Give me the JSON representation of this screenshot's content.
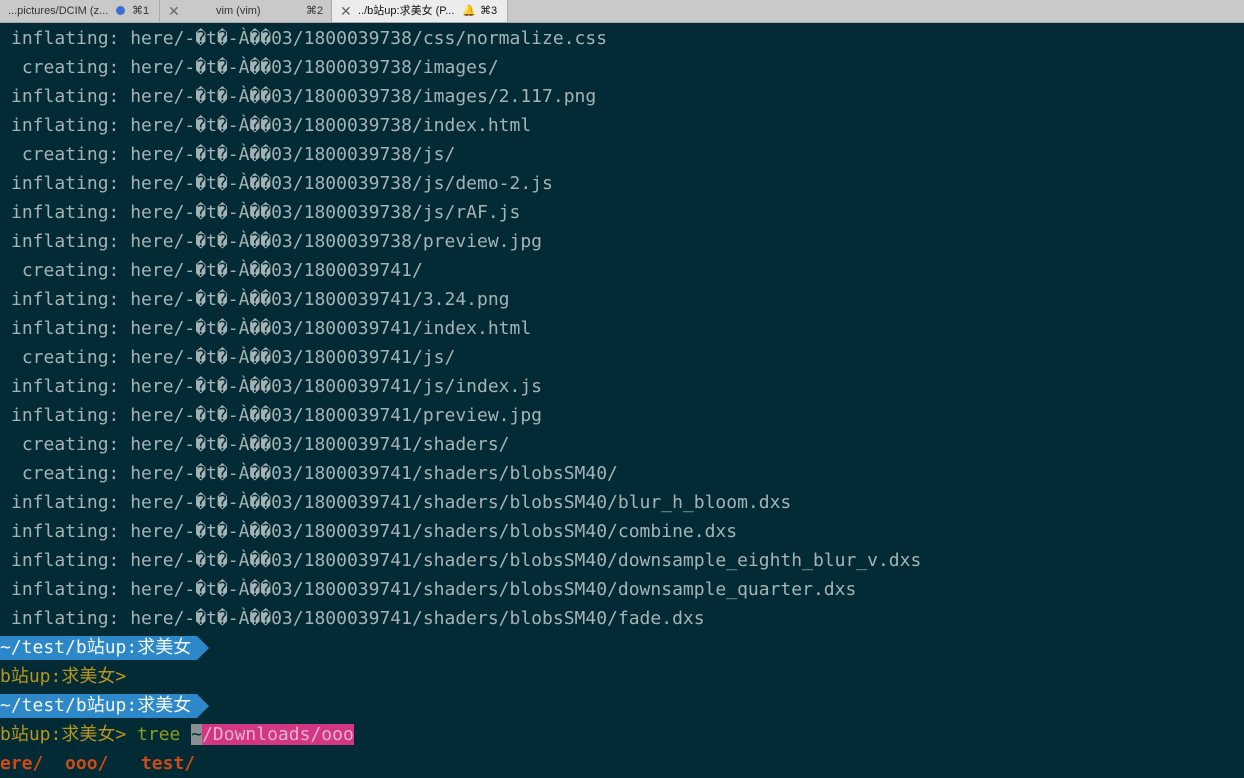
{
  "tabs": [
    {
      "title": "...pictures/DCIM (z...",
      "shortcut": "⌘1"
    },
    {
      "title": "vim (vim)",
      "shortcut": "⌘2"
    },
    {
      "title": "../b站up:求美女 (P...",
      "shortcut": "⌘3"
    }
  ],
  "output": [
    {
      "verb": "inflating:",
      "path": "here/-�t�-À��03/1800039738/css/normalize.css"
    },
    {
      "verb": " creating:",
      "path": "here/-�t�-À��03/1800039738/images/"
    },
    {
      "verb": "inflating:",
      "path": "here/-�t�-À��03/1800039738/images/2.117.png"
    },
    {
      "verb": "inflating:",
      "path": "here/-�t�-À��03/1800039738/index.html"
    },
    {
      "verb": " creating:",
      "path": "here/-�t�-À��03/1800039738/js/"
    },
    {
      "verb": "inflating:",
      "path": "here/-�t�-À��03/1800039738/js/demo-2.js"
    },
    {
      "verb": "inflating:",
      "path": "here/-�t�-À��03/1800039738/js/rAF.js"
    },
    {
      "verb": "inflating:",
      "path": "here/-�t�-À��03/1800039738/preview.jpg"
    },
    {
      "verb": " creating:",
      "path": "here/-�t�-À��03/1800039741/"
    },
    {
      "verb": "inflating:",
      "path": "here/-�t�-À��03/1800039741/3.24.png"
    },
    {
      "verb": "inflating:",
      "path": "here/-�t�-À��03/1800039741/index.html"
    },
    {
      "verb": " creating:",
      "path": "here/-�t�-À��03/1800039741/js/"
    },
    {
      "verb": "inflating:",
      "path": "here/-�t�-À��03/1800039741/js/index.js"
    },
    {
      "verb": "inflating:",
      "path": "here/-�t�-À��03/1800039741/preview.jpg"
    },
    {
      "verb": " creating:",
      "path": "here/-�t�-À��03/1800039741/shaders/"
    },
    {
      "verb": " creating:",
      "path": "here/-�t�-À��03/1800039741/shaders/blobsSM40/"
    },
    {
      "verb": "inflating:",
      "path": "here/-�t�-À��03/1800039741/shaders/blobsSM40/blur_h_bloom.dxs"
    },
    {
      "verb": "inflating:",
      "path": "here/-�t�-À��03/1800039741/shaders/blobsSM40/combine.dxs"
    },
    {
      "verb": "inflating:",
      "path": "here/-�t�-À��03/1800039741/shaders/blobsSM40/downsample_eighth_blur_v.dxs"
    },
    {
      "verb": "inflating:",
      "path": "here/-�t�-À��03/1800039741/shaders/blobsSM40/downsample_quarter.dxs"
    },
    {
      "verb": "inflating:",
      "path": "here/-�t�-À��03/1800039741/shaders/blobsSM40/fade.dxs"
    }
  ],
  "path_segment_1": "~/test/b站up:求美女",
  "prompt_1": "b站up:求美女>",
  "path_segment_2": "~/test/b站up:求美女",
  "prompt_2": "b站up:求美女>",
  "command": "tree",
  "cursor_char": "~",
  "suggestion": "/Downloads/ooo",
  "tree_items": [
    "ere/",
    "ooo/",
    "test/"
  ]
}
